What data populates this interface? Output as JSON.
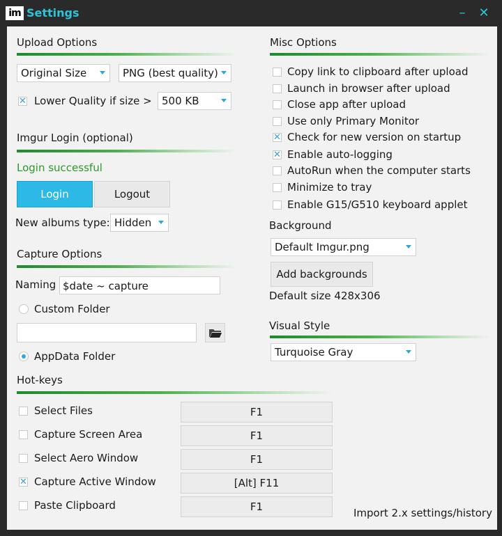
{
  "window": {
    "logo": "im",
    "title": "Settings",
    "minimize": "–",
    "close": "✕"
  },
  "upload": {
    "heading": "Upload Options",
    "size_value": "Original Size",
    "format_value": "PNG (best quality)",
    "lower_quality_label": "Lower Quality if size >",
    "lower_quality_checked": true,
    "size_limit_value": "500 KB"
  },
  "login": {
    "heading": "Imgur Login (optional)",
    "status": "Login successful",
    "login_label": "Login",
    "logout_label": "Logout",
    "albums_label": "New albums type:",
    "albums_value": "Hidden"
  },
  "capture": {
    "heading": "Capture Options",
    "naming_label": "Naming",
    "naming_value": "$date ~ capture",
    "custom_folder_label": "Custom Folder",
    "custom_folder_value": "",
    "appdata_folder_label": "AppData Folder"
  },
  "misc": {
    "heading": "Misc Options",
    "options": [
      {
        "label": "Copy link to clipboard after upload",
        "checked": false
      },
      {
        "label": "Launch in browser after upload",
        "checked": false
      },
      {
        "label": "Close app after upload",
        "checked": false
      },
      {
        "label": "Use only Primary Monitor",
        "checked": false
      },
      {
        "label": "Check for new version on startup",
        "checked": true
      },
      {
        "label": "Enable auto-logging",
        "checked": true
      },
      {
        "label": "AutoRun when the computer starts",
        "checked": false
      },
      {
        "label": "Minimize to tray",
        "checked": false
      },
      {
        "label": "Enable G15/G510 keyboard applet",
        "checked": false
      }
    ]
  },
  "background": {
    "heading": "Background",
    "value": "Default Imgur.png",
    "add_label": "Add backgrounds",
    "default_size": "Default size 428x306"
  },
  "visual_style": {
    "heading": "Visual Style",
    "value": "Turquoise Gray"
  },
  "hotkeys": {
    "heading": "Hot-keys",
    "items": [
      {
        "label": "Select Files",
        "key": "F1",
        "checked": false
      },
      {
        "label": "Capture Screen Area",
        "key": "F1",
        "checked": false
      },
      {
        "label": "Select Aero Window",
        "key": "F1",
        "checked": false
      },
      {
        "label": "Capture Active Window",
        "key": "[Alt] F11",
        "checked": true
      },
      {
        "label": "Paste Clipboard",
        "key": "F1",
        "checked": false
      }
    ]
  },
  "footer": {
    "import_label": "Import 2.x settings/history"
  }
}
